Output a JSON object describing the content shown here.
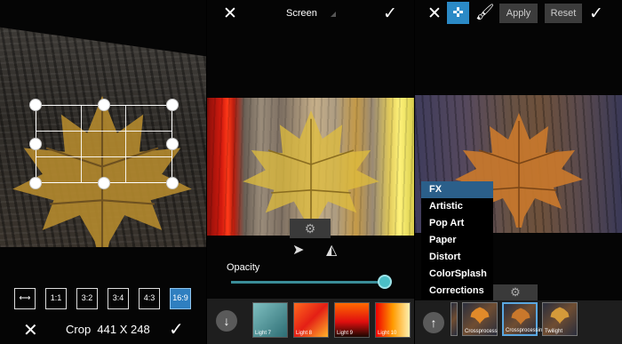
{
  "crop_panel": {
    "aspect_ratios": [
      {
        "label": "⟷",
        "name": "free"
      },
      {
        "label": "1:1",
        "name": "1-1"
      },
      {
        "label": "3:2",
        "name": "3-2"
      },
      {
        "label": "3:4",
        "name": "3-4"
      },
      {
        "label": "4:3",
        "name": "4-3"
      },
      {
        "label": "16:9",
        "name": "16-9",
        "active": true
      }
    ],
    "crop_label": "Crop",
    "crop_size": "441 X 248",
    "cancel_icon": "✕",
    "confirm_icon": "✓"
  },
  "blend_panel": {
    "cancel_icon": "✕",
    "blend_mode": "Screen",
    "confirm_icon": "✓",
    "gear_icon": "⚙",
    "send_icon": "➤",
    "flip_icon": "◭",
    "opacity_label": "Opacity",
    "opacity_value": 1.0,
    "down_icon": "↓",
    "overlays": [
      {
        "label": "Light 7"
      },
      {
        "label": "Light 8"
      },
      {
        "label": "Light 9"
      },
      {
        "label": "Light 10"
      }
    ]
  },
  "effects_panel": {
    "cancel_icon": "✕",
    "move_icon": "✜",
    "brush_icon": "🖌",
    "apply_label": "Apply",
    "reset_label": "Reset",
    "confirm_icon": "✓",
    "menu": [
      "FX",
      "Artistic",
      "Pop Art",
      "Paper",
      "Distort",
      "ColorSplash",
      "Corrections"
    ],
    "menu_selected": "FX",
    "gear_icon": "⚙",
    "up_icon": "↑",
    "effects": [
      {
        "label": "Crossprocess"
      },
      {
        "label": "Crossprocessin"
      },
      {
        "label": "Twilight"
      }
    ]
  },
  "colors": {
    "accent": "#2b8ac6",
    "slider": "#4bbfc7",
    "leaf": "#c79a2c"
  }
}
